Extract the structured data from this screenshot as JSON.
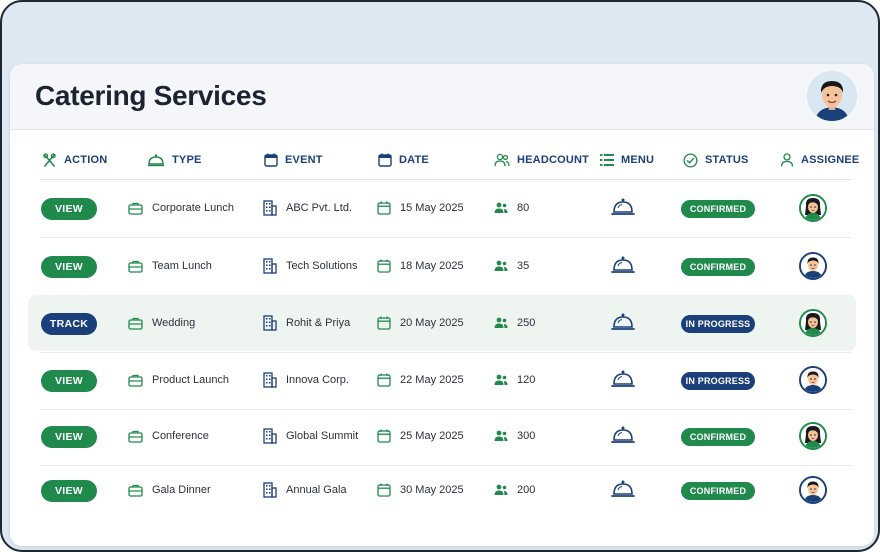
{
  "page_title": "Catering Services",
  "columns": {
    "action": "ACTION",
    "type": "TYPE",
    "event": "EVENT",
    "date": "DATE",
    "headcount": "HEADCOUNT",
    "menu": "MENU",
    "status": "STATUS",
    "assignee": "ASSIGNEE"
  },
  "icons": {
    "action": "utensils-icon",
    "type": "cloche-icon",
    "event": "calendar-icon",
    "date": "calendar-icon",
    "headcount": "people-icon",
    "menu": "list-icon",
    "status": "check-circle-icon",
    "assignee": "user-icon",
    "row_type": "briefcase-icon",
    "row_event": "building-icon",
    "row_date": "calendar-icon",
    "row_headcount": "people-icon",
    "row_menu": "cloche-icon"
  },
  "colors": {
    "green": "#1f8a4c",
    "navy": "#1b3f7a",
    "highlight_row": "#eef5f0"
  },
  "rows": [
    {
      "action": "VIEW",
      "type": "Corporate Lunch",
      "event": "ABC Pvt. Ltd.",
      "date": "15 May 2025",
      "headcount": "80",
      "status": "CONFIRMED",
      "assignee": "female"
    },
    {
      "action": "VIEW",
      "type": "Team Lunch",
      "event": "Tech Solutions",
      "date": "18 May 2025",
      "headcount": "35",
      "status": "CONFIRMED",
      "assignee": "male"
    },
    {
      "action": "TRACK",
      "type": "Wedding",
      "event": "Rohit & Priya",
      "date": "20 May 2025",
      "headcount": "250",
      "status": "IN PROGRESS",
      "assignee": "female"
    },
    {
      "action": "VIEW",
      "type": "Product Launch",
      "event": "Innova Corp.",
      "date": "22 May 2025",
      "headcount": "120",
      "status": "IN PROGRESS",
      "assignee": "male"
    },
    {
      "action": "VIEW",
      "type": "Conference",
      "event": "Global Summit",
      "date": "25 May 2025",
      "headcount": "300",
      "status": "CONFIRMED",
      "assignee": "female"
    },
    {
      "action": "VIEW",
      "type": "Gala Dinner",
      "event": "Annual Gala",
      "date": "30 May 2025",
      "headcount": "200",
      "status": "CONFIRMED",
      "assignee": "male"
    }
  ]
}
